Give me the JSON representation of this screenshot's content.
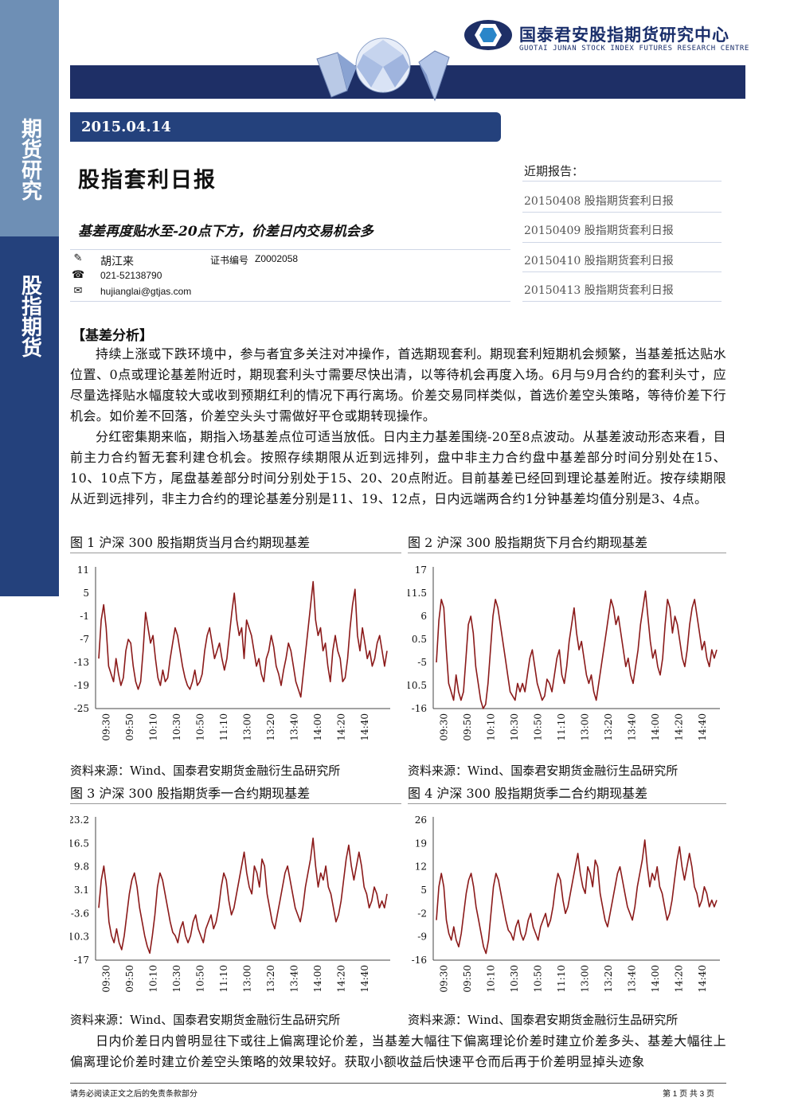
{
  "brand": {
    "accent": "#24417c",
    "light": "#6e8fb5",
    "chart_line": "#8b1a1a"
  },
  "sidebar": {
    "top_label": "期货研究",
    "bottom_label": "股指期货"
  },
  "header": {
    "org_cn": "国泰君安股指期货研究中心",
    "org_en": "GUOTAI JUNAN STOCK INDEX FUTURES RESEARCH CENTRE",
    "logo_icon": "guotai-junan-logo-icon",
    "gem_image": "diamond-banner-icon"
  },
  "date": "2015.04.14",
  "title": "股指套利日报",
  "subtitle": "基差再度贴水至-20点下方，价差日内交易机会多",
  "recent": {
    "heading": "近期报告：",
    "items": [
      "20150408 股指期货套利日报",
      "20150409 股指期货套利日报",
      "20150410 股指期货套利日报",
      "20150413 股指期货套利日报"
    ]
  },
  "author": {
    "name": "胡江来",
    "cert_label": "证书编号",
    "cert_no": "Z0002058",
    "phone": "021-52138790",
    "email": "hujianglai@gtjas.com",
    "pen_icon": "pen-icon",
    "phone_icon": "phone-icon",
    "mail_icon": "mail-icon"
  },
  "section": "【基差分析】",
  "paragraphs": [
    "持续上涨或下跌环境中，参与者宜多关注对冲操作，首选期现套利。期现套利短期机会频繁，当基差抵达贴水位置、0点或理论基差附近时，期现套利头寸需要尽快出清，以等待机会再度入场。6月与9月合约的套利头寸，应尽量选择贴水幅度较大或收到预期红利的情况下再行离场。价差交易同样类似，首选价差空头策略，等待价差下行机会。如价差不回落，价差空头头寸需做好平仓或期转现操作。",
    "分红密集期来临，期指入场基差点位可适当放低。日内主力基差围绕-20至8点波动。从基差波动形态来看，目前主力合约暂无套利建仓机会。按照存续期限从近到远排列，盘中非主力合约盘中基差部分时间分别处在15、10、10点下方，尾盘基差部分时间分别处于15、20、20点附近。目前基差已经回到理论基差附近。按存续期限从近到远排列，非主力合约的理论基差分别是11、19、12点，日内远端两合约1分钟基差均值分别是3、4点。",
    "日内价差日内曾明显往下或往上偏离理论价差，当基差大幅往下偏离理论价差时建立价差多头、基差大幅往上偏离理论价差时建立价差空头策略的效果较好。获取小额收益后快速平仓而后再于价差明显掉头迹象"
  ],
  "source_text": "资料来源：Wind、国泰君安期货金融衍生品研究所",
  "figures": [
    {
      "title": "图 1 沪深 300 股指期货当月合约期现基差"
    },
    {
      "title": "图 2 沪深 300 股指期货下月合约期现基差"
    },
    {
      "title": "图 3 沪深 300 股指期货季一合约期现基差"
    },
    {
      "title": "图 4 沪深 300 股指期货季二合约期现基差"
    }
  ],
  "chart_data": [
    {
      "type": "line",
      "x_ticks": [
        "09:30",
        "09:50",
        "10:10",
        "10:30",
        "10:50",
        "11:10",
        "13:00",
        "13:20",
        "13:40",
        "14:00",
        "14:20",
        "14:40"
      ],
      "y_ticks": [
        "11",
        "5",
        "-1",
        "-7",
        "-13",
        "-19",
        "-25"
      ],
      "ylim": [
        -25,
        11
      ],
      "series": [
        {
          "values": [
            -12,
            -2,
            2,
            -4,
            -14,
            -16,
            -18,
            -12,
            -16,
            -19,
            -17,
            -10,
            -7,
            -8,
            -14,
            -18,
            -20,
            -18,
            -10,
            0,
            -4,
            -8,
            -6,
            -12,
            -17,
            -19,
            -15,
            -18,
            -17,
            -12,
            -8,
            -4,
            -6,
            -10,
            -14,
            -17,
            -19,
            -20,
            -18,
            -15,
            -19,
            -18,
            -16,
            -10,
            -6,
            -4,
            -8,
            -12,
            -10,
            -8,
            -12,
            -15,
            -12,
            -6,
            0,
            5,
            -2,
            -6,
            -4,
            -12,
            -2,
            -4,
            -6,
            -10,
            -14,
            -12,
            -16,
            -18,
            -12,
            -10,
            -6,
            -9,
            -14,
            -16,
            -19,
            -15,
            -12,
            -8,
            -10,
            -14,
            -18,
            -20,
            -22,
            -16,
            -10,
            -4,
            2,
            8,
            -2,
            -6,
            -4,
            -10,
            -8,
            -14,
            -18,
            -10,
            -6,
            -10,
            -12,
            -18,
            -17,
            -12,
            -4,
            2,
            6,
            -6,
            -10,
            -4,
            -8,
            -12,
            -10,
            -14,
            -12,
            -8,
            -6,
            -10,
            -14,
            -10
          ]
        }
      ]
    },
    {
      "type": "line",
      "x_ticks": [
        "09:30",
        "09:50",
        "10:10",
        "10:30",
        "10:50",
        "11:10",
        "13:00",
        "13:20",
        "13:40",
        "14:00",
        "14:20",
        "14:40"
      ],
      "y_ticks": [
        "17",
        "11.5",
        "6",
        "0.5",
        "-5",
        "-10.5",
        "-16"
      ],
      "ylim": [
        -16,
        17
      ],
      "series": [
        {
          "values": [
            -5,
            5,
            10,
            8,
            -2,
            -10,
            -12,
            -14,
            -8,
            -12,
            -14,
            -12,
            -4,
            4,
            6,
            2,
            -6,
            -10,
            -14,
            -16,
            -15,
            -10,
            -2,
            6,
            10,
            8,
            4,
            0,
            -4,
            -8,
            -12,
            -13,
            -14,
            -10,
            -12,
            -10,
            -12,
            -8,
            -4,
            -2,
            -6,
            -10,
            -12,
            -14,
            -13,
            -9,
            -10,
            -12,
            -8,
            -4,
            -2,
            -8,
            -10,
            -6,
            0,
            4,
            8,
            2,
            -2,
            0,
            -4,
            -8,
            -10,
            -8,
            -12,
            -14,
            -10,
            -6,
            -2,
            2,
            6,
            10,
            8,
            4,
            6,
            2,
            -2,
            -6,
            -4,
            -8,
            -10,
            -6,
            -2,
            4,
            8,
            12,
            6,
            0,
            -4,
            -2,
            -6,
            -8,
            -4,
            4,
            10,
            8,
            2,
            6,
            4,
            0,
            -4,
            -6,
            -2,
            4,
            8,
            10,
            6,
            2,
            -2,
            0,
            -4,
            -6,
            -2,
            -4,
            -2
          ]
        }
      ]
    },
    {
      "type": "line",
      "x_ticks": [
        "09:30",
        "09:50",
        "10:10",
        "10:30",
        "10:50",
        "11:10",
        "13:00",
        "13:20",
        "13:40",
        "14:00",
        "14:20",
        "14:40"
      ],
      "y_ticks": [
        "23.2",
        "16.5",
        "9.8",
        "3.1",
        "-3.6",
        "-10.3",
        "-17"
      ],
      "ylim": [
        -17,
        23.2
      ],
      "series": [
        {
          "values": [
            -2,
            6,
            10,
            4,
            -6,
            -10,
            -12,
            -8,
            -12,
            -14,
            -10,
            -4,
            2,
            6,
            8,
            4,
            -2,
            -6,
            -10,
            -13,
            -15,
            -10,
            -4,
            4,
            8,
            6,
            2,
            -2,
            -6,
            -9,
            -10,
            -12,
            -8,
            -6,
            -10,
            -12,
            -10,
            -6,
            -4,
            -8,
            -10,
            -12,
            -8,
            -6,
            -4,
            -8,
            -6,
            -2,
            4,
            8,
            6,
            0,
            -4,
            -2,
            2,
            6,
            10,
            14,
            8,
            4,
            2,
            10,
            8,
            4,
            12,
            10,
            2,
            -2,
            -6,
            -8,
            -4,
            0,
            4,
            8,
            10,
            6,
            2,
            -2,
            -4,
            -6,
            -2,
            4,
            8,
            12,
            18,
            10,
            4,
            8,
            6,
            10,
            4,
            2,
            -2,
            -6,
            -4,
            0,
            6,
            12,
            16,
            10,
            6,
            10,
            14,
            10,
            4,
            2,
            -2,
            0,
            4,
            2,
            -2,
            0,
            -2,
            2
          ]
        }
      ]
    },
    {
      "type": "line",
      "x_ticks": [
        "09:30",
        "09:50",
        "10:10",
        "10:30",
        "10:50",
        "11:10",
        "13:00",
        "13:20",
        "13:40",
        "14:00",
        "14:20",
        "14:40"
      ],
      "y_ticks": [
        "26",
        "19",
        "12",
        "5",
        "-2",
        "-9",
        "-16"
      ],
      "ylim": [
        -16,
        26
      ],
      "series": [
        {
          "values": [
            -4,
            6,
            10,
            6,
            -4,
            -8,
            -10,
            -6,
            -10,
            -12,
            -8,
            -2,
            4,
            8,
            10,
            6,
            0,
            -4,
            -8,
            -12,
            -14,
            -10,
            -2,
            6,
            10,
            8,
            4,
            0,
            -4,
            -7,
            -8,
            -10,
            -6,
            -4,
            -8,
            -10,
            -8,
            -4,
            -2,
            -6,
            -8,
            -10,
            -6,
            -4,
            -2,
            -6,
            -4,
            0,
            6,
            10,
            8,
            2,
            -2,
            0,
            4,
            8,
            12,
            16,
            10,
            6,
            4,
            12,
            10,
            6,
            14,
            12,
            4,
            0,
            -4,
            -6,
            -2,
            2,
            6,
            10,
            12,
            8,
            4,
            0,
            -2,
            -4,
            0,
            6,
            10,
            14,
            20,
            12,
            6,
            10,
            8,
            12,
            6,
            4,
            0,
            -4,
            -2,
            2,
            8,
            14,
            18,
            12,
            8,
            12,
            16,
            12,
            6,
            4,
            0,
            2,
            6,
            4,
            0,
            2,
            0,
            2
          ]
        }
      ]
    }
  ],
  "footer": {
    "left": "请务必阅读正文之后的免责条款部分",
    "right": "第 1 页 共 3 页"
  }
}
